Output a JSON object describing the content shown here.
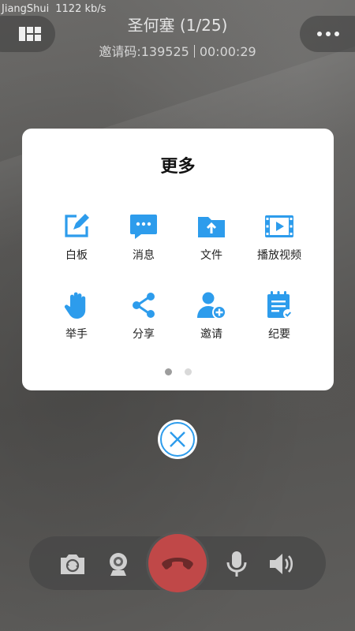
{
  "status": {
    "user": "JiangShui",
    "bitrate": "1122 kb/s"
  },
  "header": {
    "title": "圣何塞 (1/25)",
    "invite": "邀请码:139525",
    "duration": "00:00:29"
  },
  "more_panel": {
    "title": "更多",
    "items": [
      {
        "label": "白板",
        "icon": "whiteboard-icon"
      },
      {
        "label": "消息",
        "icon": "message-icon"
      },
      {
        "label": "文件",
        "icon": "folder-upload-icon"
      },
      {
        "label": "播放视频",
        "icon": "play-video-icon"
      },
      {
        "label": "举手",
        "icon": "raise-hand-icon"
      },
      {
        "label": "分享",
        "icon": "share-icon"
      },
      {
        "label": "邀请",
        "icon": "invite-user-icon"
      },
      {
        "label": "纪要",
        "icon": "notes-icon"
      }
    ],
    "page": {
      "current": 1,
      "total": 2
    }
  },
  "colors": {
    "accent": "#2d9cec",
    "hangup": "#c04848"
  }
}
